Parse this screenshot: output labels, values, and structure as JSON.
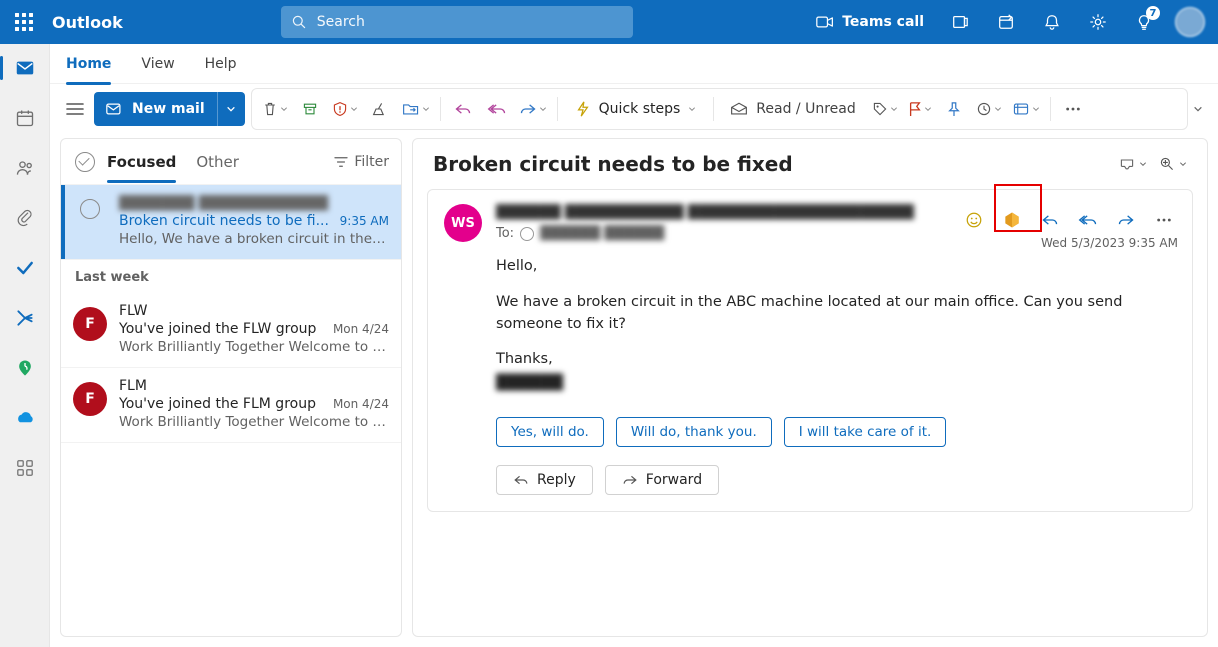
{
  "brand": "Outlook",
  "search": {
    "placeholder": "Search"
  },
  "top": {
    "teams_call": "Teams call",
    "badge": "7"
  },
  "tabs": {
    "home": "Home",
    "view": "View",
    "help": "Help"
  },
  "ribbon": {
    "newmail": "New mail",
    "quicksteps": "Quick steps",
    "readunread": "Read / Unread"
  },
  "list": {
    "pivot": {
      "focused": "Focused",
      "other": "Other"
    },
    "filter": "Filter",
    "section_lastweek": "Last week",
    "msgs": [
      {
        "from": "███████ ████████████",
        "subject": "Broken circuit needs to be fi...",
        "time": "9:35 AM",
        "preview": "Hello, We have a broken circuit in the A..."
      },
      {
        "initial": "F",
        "from": "FLW",
        "subject": "You've joined the FLW group",
        "time": "Mon 4/24",
        "preview": "Work Brilliantly Together Welcome to t..."
      },
      {
        "initial": "F",
        "from": "FLM",
        "subject": "You've joined the FLM group",
        "time": "Mon 4/24",
        "preview": "Work Brilliantly Together Welcome to t..."
      }
    ]
  },
  "read": {
    "title": "Broken circuit needs to be fixed",
    "avatar_initials": "WS",
    "sender_blur": "██████ ███████████ █████████████████████",
    "to_label": "To:",
    "to_name_blur": "██████ ██████",
    "received": "Wed 5/3/2023 9:35 AM",
    "body": {
      "p1": "Hello,",
      "p2": "We have a broken circuit in the ABC machine located at   our main office. Can you send someone to fix it?",
      "p3": "Thanks,",
      "sig": "██████"
    },
    "suggestions": [
      "Yes, will do.",
      "Will do, thank you.",
      "I will take care of it."
    ],
    "reply": "Reply",
    "forward": "Forward"
  }
}
